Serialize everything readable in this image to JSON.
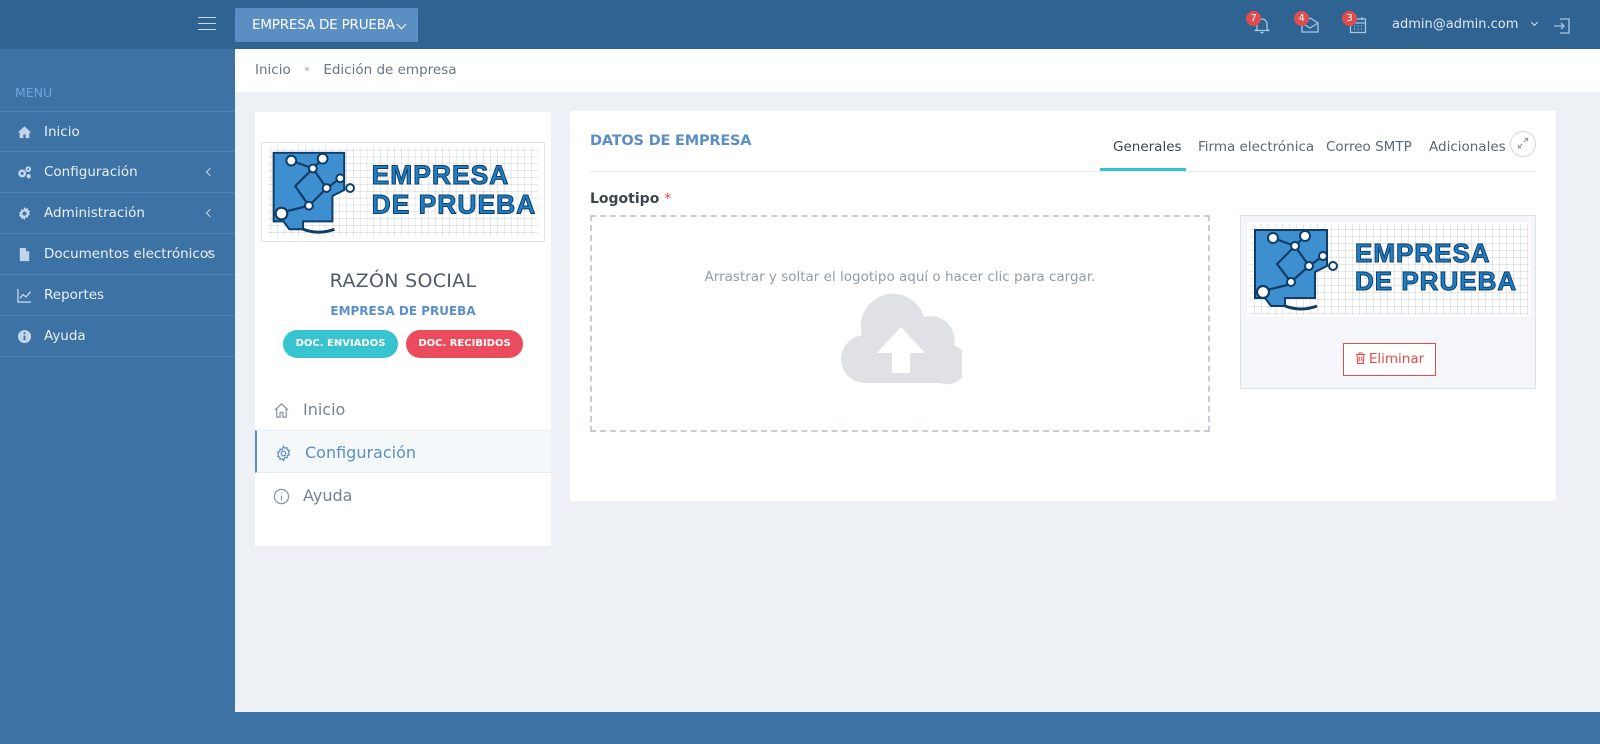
{
  "topbar": {
    "company_selector": "EMPRESA DE PRUEBA",
    "notifications": {
      "count": "7"
    },
    "messages": {
      "count": "4"
    },
    "calendar": {
      "count": "3"
    },
    "user_email": "admin@admin.com"
  },
  "sidebar": {
    "menu_title": "MENU",
    "items": [
      {
        "label": "Inicio",
        "icon": "home-icon"
      },
      {
        "label": "Configuración",
        "icon": "gears-icon"
      },
      {
        "label": "Administración",
        "icon": "gear-icon"
      },
      {
        "label": "Documentos electrónicos",
        "icon": "document-icon"
      },
      {
        "label": "Reportes",
        "icon": "chart-line-icon"
      },
      {
        "label": "Ayuda",
        "icon": "info-icon"
      }
    ]
  },
  "breadcrumb": {
    "home": "Inicio",
    "current": "Edición de empresa"
  },
  "profile_card": {
    "logo_text_line1": "EMPRESA",
    "logo_text_line2": "DE PRUEBA",
    "title": "RAZÓN SOCIAL",
    "subtitle": "EMPRESA DE PRUEBA",
    "sent_button": "DOC. ENVIADOS",
    "received_button": "DOC. RECIBIDOS",
    "nav": [
      {
        "label": "Inicio",
        "icon": "home-icon"
      },
      {
        "label": "Configuración",
        "icon": "gear-icon"
      },
      {
        "label": "Ayuda",
        "icon": "info-icon"
      }
    ]
  },
  "main_card": {
    "title": "DATOS DE EMPRESA",
    "tabs": [
      "Generales",
      "Firma electrónica",
      "Correo SMTP",
      "Adicionales"
    ],
    "active_tab": "Generales",
    "logo_field": {
      "label": "Logotipo",
      "required_mark": "*",
      "dropzone_text": "Arrastrar y soltar el logotipo aquí o hacer clic para cargar.",
      "delete_button": "Eliminar"
    }
  },
  "colors": {
    "topbar": "#2f6391",
    "sidebar": "#3d72a4",
    "accent": "#5b8fc4",
    "teal": "#37c4cf",
    "danger": "#ea4c5d"
  }
}
